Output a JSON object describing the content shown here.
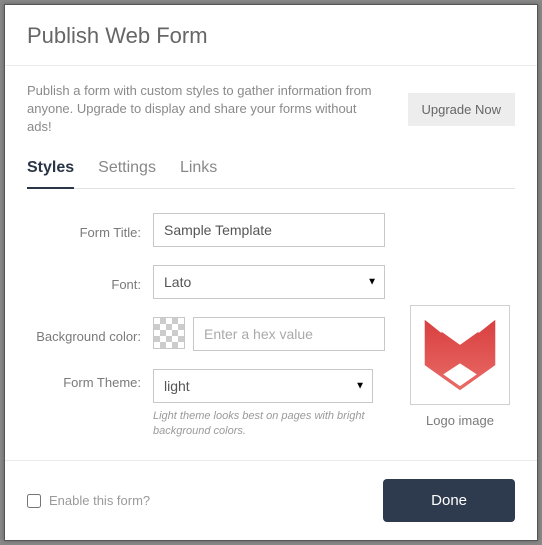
{
  "header": {
    "title": "Publish Web Form"
  },
  "upgrade": {
    "text": "Publish a form with custom styles to gather information from anyone. Upgrade to display and share your forms without ads!",
    "button": "Upgrade Now"
  },
  "tabs": {
    "styles": "Styles",
    "settings": "Settings",
    "links": "Links"
  },
  "fields": {
    "formTitle": {
      "label": "Form Title:",
      "value": "Sample Template"
    },
    "font": {
      "label": "Font:",
      "value": "Lato"
    },
    "bgColor": {
      "label": "Background color:",
      "placeholder": "Enter a hex value",
      "value": ""
    },
    "theme": {
      "label": "Form Theme:",
      "value": "light",
      "hint": "Light theme looks best on pages with bright background colors."
    }
  },
  "logo": {
    "caption": "Logo image"
  },
  "footer": {
    "enableLabel": "Enable this form?",
    "enableChecked": false,
    "done": "Done"
  }
}
